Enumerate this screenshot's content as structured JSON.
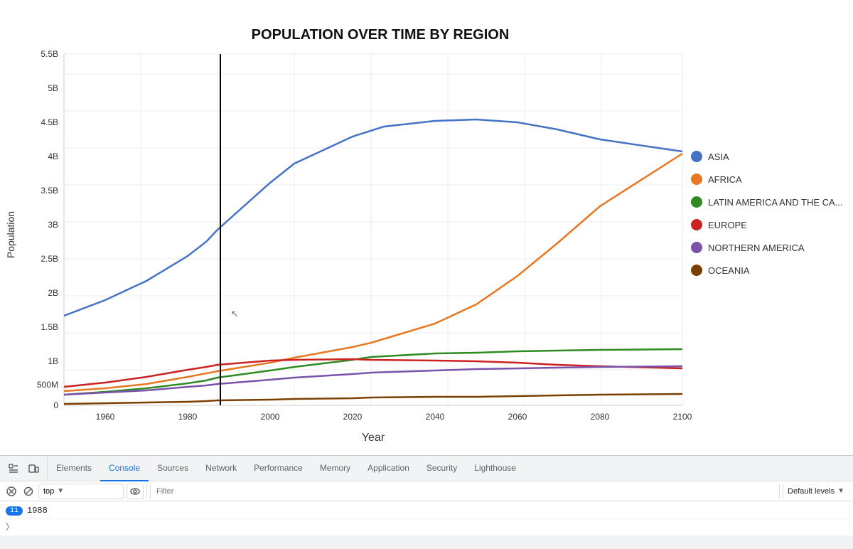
{
  "chart": {
    "title": "POPULATION OVER TIME BY REGION",
    "x_label": "Year",
    "y_label": "Population",
    "y_ticks": [
      "5.5B",
      "5B",
      "4.5B",
      "4B",
      "3.5B",
      "3B",
      "2.5B",
      "2B",
      "1.5B",
      "1B",
      "500M",
      "0"
    ],
    "x_ticks": [
      "1960",
      "1980",
      "2000",
      "2020",
      "2040",
      "2060",
      "2080",
      "2100"
    ],
    "vertical_line_year": "1988",
    "legend": [
      {
        "label": "ASIA",
        "color": "#4472C4"
      },
      {
        "label": "AFRICA",
        "color": "#E87722"
      },
      {
        "label": "LATIN AMERICA AND THE CA...",
        "color": "#2E8B22"
      },
      {
        "label": "EUROPE",
        "color": "#CC2222"
      },
      {
        "label": "NORTHERN AMERICA",
        "color": "#7B52AB"
      },
      {
        "label": "OCEANIA",
        "color": "#7B3F00"
      }
    ]
  },
  "devtools": {
    "tabs": [
      {
        "label": "Elements",
        "active": false
      },
      {
        "label": "Console",
        "active": true
      },
      {
        "label": "Sources",
        "active": false
      },
      {
        "label": "Network",
        "active": false
      },
      {
        "label": "Performance",
        "active": false
      },
      {
        "label": "Memory",
        "active": false
      },
      {
        "label": "Application",
        "active": false
      },
      {
        "label": "Security",
        "active": false
      },
      {
        "label": "Lighthouse",
        "active": false
      }
    ],
    "toolbar": {
      "context_value": "top",
      "filter_placeholder": "Filter",
      "log_level": "Default levels"
    },
    "console_output": [
      {
        "count": "11",
        "text": "1988"
      },
      {
        "caret": true,
        "text": ""
      }
    ]
  }
}
